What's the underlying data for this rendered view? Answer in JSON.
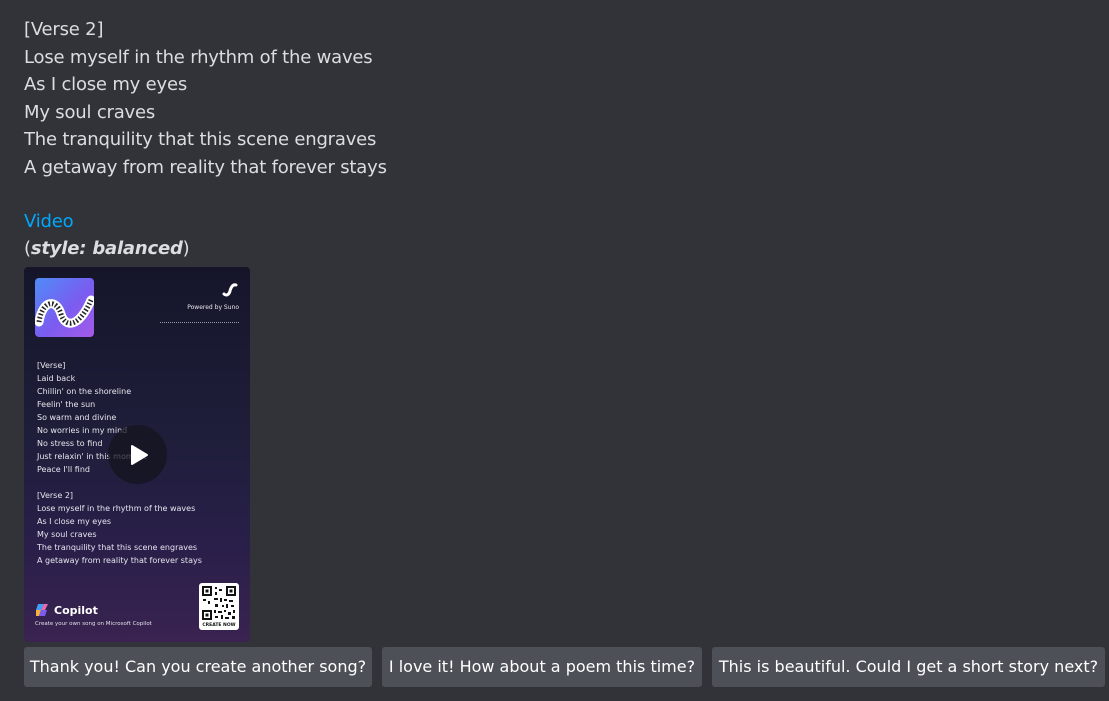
{
  "message": {
    "lyrics": [
      "[Verse 2]",
      "Lose myself in the rhythm of the waves",
      "As I close my eyes",
      "My soul craves",
      "The tranquility that this scene engraves",
      "A getaway from reality that forever stays"
    ],
    "video_link": "Video",
    "style_open": "(",
    "style_bold": "style: balanced",
    "style_close": ")"
  },
  "video_card": {
    "powered_by": "Powered by Suno",
    "lyrics_verse1": [
      "[Verse]",
      "Laid back",
      "Chillin' on the shoreline",
      "Feelin' the sun",
      "So warm and divine",
      "No worries in my mind",
      "No stress to find",
      "Just relaxin' in this moment",
      "Peace I'll find"
    ],
    "lyrics_verse2": [
      "[Verse 2]",
      "Lose myself in the rhythm of the waves",
      "As I close my eyes",
      "My soul craves",
      "The tranquility that this scene engraves",
      "A getaway from reality that forever stays"
    ],
    "brand": "Copilot",
    "create_text": "Create your own song on Microsoft Copilot",
    "qr_label": "CREATE NOW"
  },
  "suggestions": [
    "Thank you! Can you create another song?",
    "I love it! How about a poem this time?",
    "This is beautiful. Could I get a short story next?"
  ],
  "colors": {
    "background": "#313338",
    "link": "#00a8fc",
    "button": "#4e5058"
  }
}
